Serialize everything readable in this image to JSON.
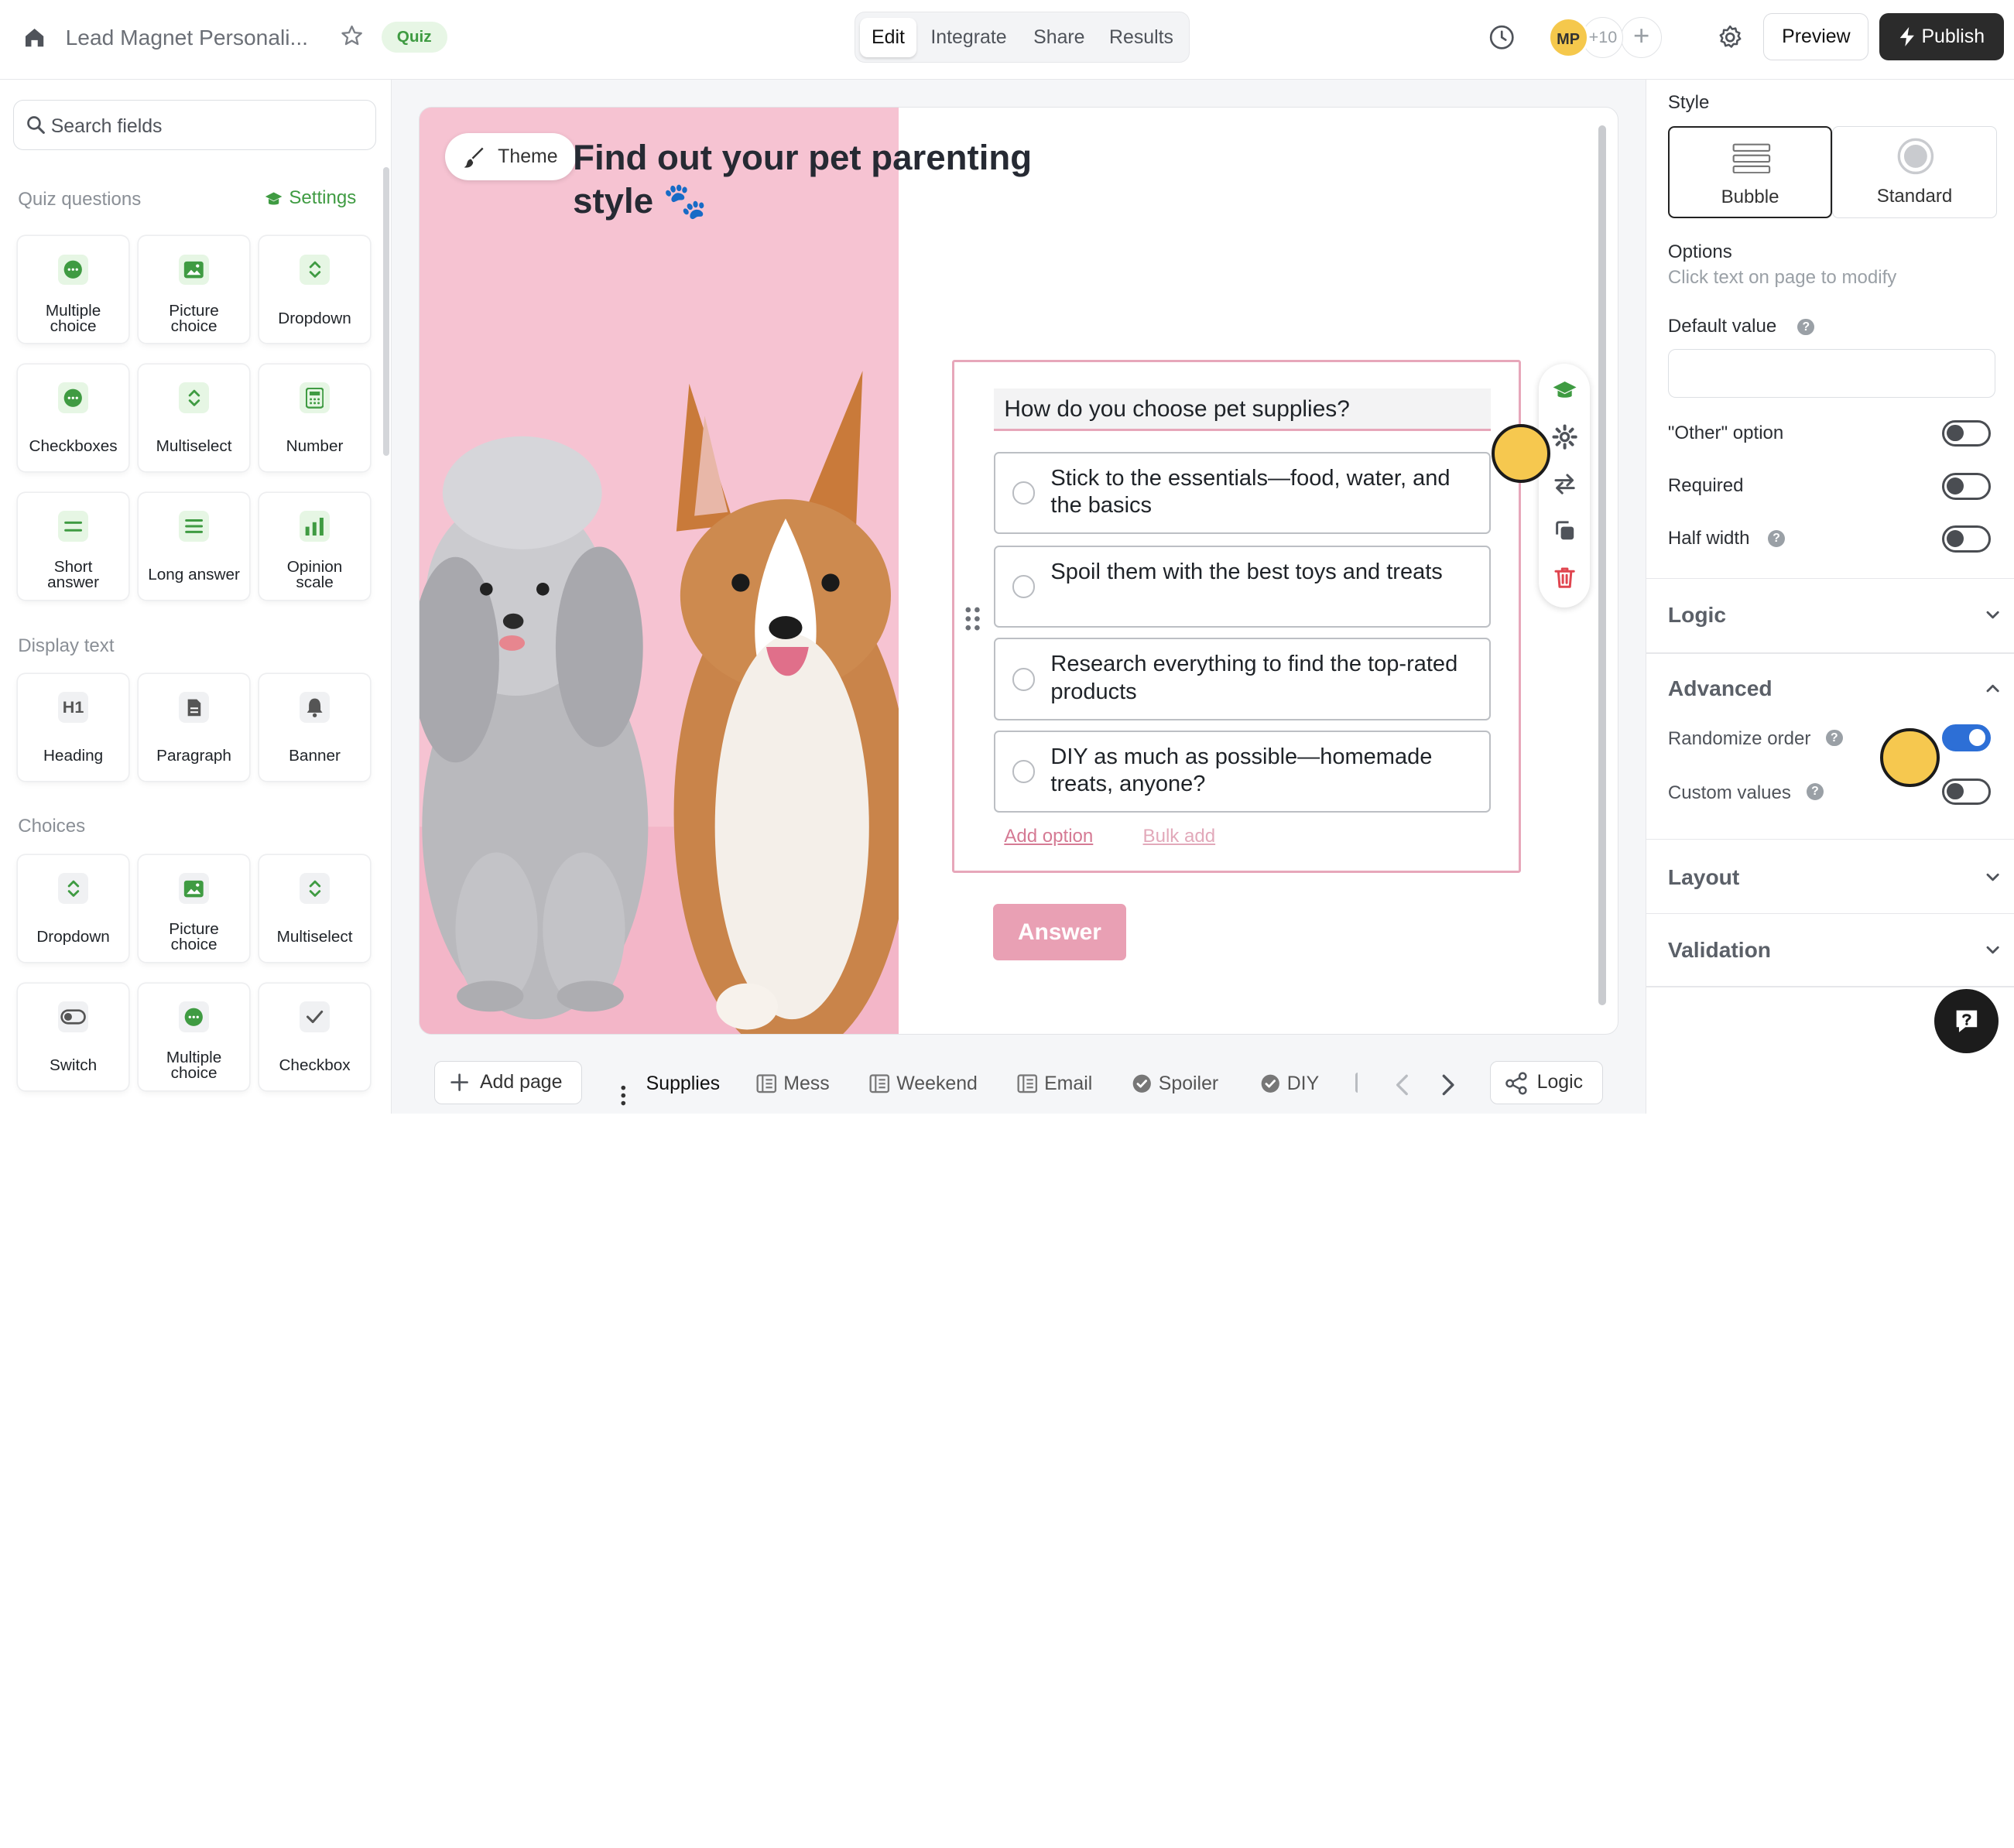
{
  "topbar": {
    "title": "Lead Magnet Personali...",
    "badge": "Quiz",
    "tabs": [
      {
        "label": "Edit",
        "active": true
      },
      {
        "label": "Integrate",
        "active": false
      },
      {
        "label": "Share",
        "active": false
      },
      {
        "label": "Results",
        "active": false
      }
    ],
    "avatar_initials": "MP",
    "collaborator_count": "+10",
    "preview_label": "Preview",
    "publish_label": "Publish"
  },
  "sidebar": {
    "search_placeholder": "Search fields",
    "quiz_questions_heading": "Quiz questions",
    "settings_label": "Settings",
    "quiz_fields": [
      {
        "label": "Multiple\nchoice",
        "icon": "chat-bubble-icon"
      },
      {
        "label": "Picture\nchoice",
        "icon": "image-icon"
      },
      {
        "label": "Dropdown",
        "icon": "chevron-updown-icon"
      },
      {
        "label": "Checkboxes",
        "icon": "chat-bubble-icon"
      },
      {
        "label": "Multiselect",
        "icon": "chevron-updown-icon"
      },
      {
        "label": "Number",
        "icon": "calculator-icon"
      },
      {
        "label": "Short\nanswer",
        "icon": "short-lines-icon"
      },
      {
        "label": "Long answer",
        "icon": "long-lines-icon"
      },
      {
        "label": "Opinion\nscale",
        "icon": "bar-chart-icon"
      }
    ],
    "display_text_heading": "Display text",
    "display_fields": [
      {
        "label": "Heading",
        "icon": "h1-icon"
      },
      {
        "label": "Paragraph",
        "icon": "document-icon"
      },
      {
        "label": "Banner",
        "icon": "bell-icon"
      }
    ],
    "choices_heading": "Choices",
    "choice_fields": [
      {
        "label": "Dropdown",
        "icon": "chevron-updown-icon"
      },
      {
        "label": "Picture\nchoice",
        "icon": "image-icon"
      },
      {
        "label": "Multiselect",
        "icon": "chevron-updown-icon"
      },
      {
        "label": "Switch",
        "icon": "toggle-icon"
      },
      {
        "label": "Multiple\nchoice",
        "icon": "chat-bubble-icon"
      },
      {
        "label": "Checkbox",
        "icon": "check-icon"
      }
    ],
    "accent_color": "#3f9b42"
  },
  "canvas": {
    "theme_label": "Theme",
    "title": "Find out your pet parenting style 🐾",
    "question": "How do you choose pet supplies?",
    "options": [
      "Stick to the essentials—food, water, and the basics",
      "Spoil them with the best toys and treats",
      "Research everything to find the top-rated products",
      "DIY as much as possible—homemade treats, anyone?"
    ],
    "add_option_label": "Add option",
    "bulk_add_label": "Bulk add",
    "answer_label": "Answer",
    "accent_color": "#e9a0b4",
    "photo_background": "#f6c3d2"
  },
  "pagebar": {
    "add_page_label": "Add page",
    "pages": [
      {
        "label": "Supplies",
        "icon": "",
        "active": true
      },
      {
        "label": "Mess",
        "icon": "form-icon"
      },
      {
        "label": "Weekend",
        "icon": "form-icon"
      },
      {
        "label": "Email",
        "icon": "form-icon"
      },
      {
        "label": "Spoiler",
        "icon": "check-circle-icon"
      },
      {
        "label": "DIY",
        "icon": "check-circle-icon"
      }
    ],
    "logic_label": "Logic"
  },
  "panel": {
    "style_label": "Style",
    "style_options": [
      {
        "label": "Bubble",
        "selected": true
      },
      {
        "label": "Standard",
        "selected": false
      }
    ],
    "options_label": "Options",
    "options_hint": "Click text on page to modify",
    "default_value_label": "Default value",
    "default_value": "",
    "other_option_label": "\"Other\" option",
    "other_option_on": false,
    "required_label": "Required",
    "required_on": false,
    "half_width_label": "Half width",
    "half_width_on": false,
    "logic_label": "Logic",
    "advanced_label": "Advanced",
    "randomize_label": "Randomize order",
    "randomize_on": true,
    "custom_values_label": "Custom values",
    "custom_values_on": false,
    "layout_label": "Layout",
    "validation_label": "Validation",
    "toggle_on_color": "#2d6fd6"
  }
}
